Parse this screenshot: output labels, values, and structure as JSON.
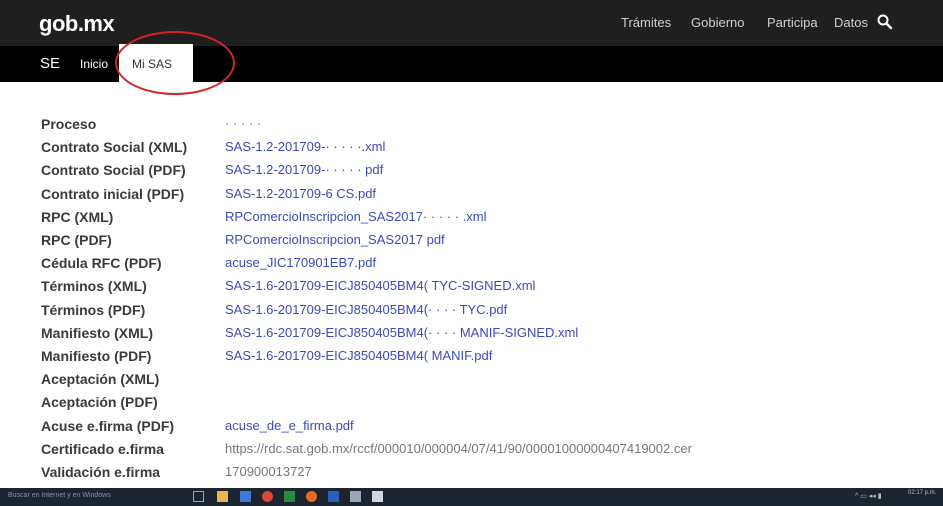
{
  "header": {
    "logo": "gob.mx",
    "nav": [
      "Trámites",
      "Gobierno",
      "Participa",
      "Datos"
    ]
  },
  "subnav": {
    "se": "SE",
    "inicio": "Inicio",
    "mi_sas": "Mi SAS"
  },
  "rows": [
    {
      "label": "Proceso",
      "value": "· · · · ·",
      "link": false
    },
    {
      "label": "Contrato Social (XML)",
      "value": "SAS-1.2-201709-· · · · ·.xml",
      "link": true
    },
    {
      "label": "Contrato Social (PDF)",
      "value": "SAS-1.2-201709-· · · · · pdf",
      "link": true
    },
    {
      "label": "Contrato inicial (PDF)",
      "value": "SAS-1.2-201709-6        CS.pdf",
      "link": true
    },
    {
      "label": "RPC (XML)",
      "value": "RPComercioInscripcion_SAS2017· · · · · .xml",
      "link": true
    },
    {
      "label": "RPC (PDF)",
      "value": "RPComercioInscripcion_SAS2017           pdf",
      "link": true
    },
    {
      "label": "Cédula RFC (PDF)",
      "value": "acuse_JIC170901EB7.pdf",
      "link": true
    },
    {
      "label": "Términos (XML)",
      "value": "SAS-1.6-201709-EICJ850405BM4(        TYC-SIGNED.xml",
      "link": true
    },
    {
      "label": "Términos (PDF)",
      "value": "SAS-1.6-201709-EICJ850405BM4(· · · · TYC.pdf",
      "link": true
    },
    {
      "label": "Manifiesto (XML)",
      "value": "SAS-1.6-201709-EICJ850405BM4(· · · · MANIF-SIGNED.xml",
      "link": true
    },
    {
      "label": "Manifiesto (PDF)",
      "value": "SAS-1.6-201709-EICJ850405BM4(         MANIF.pdf",
      "link": true
    },
    {
      "label": "Aceptación (XML)",
      "value": "",
      "link": false
    },
    {
      "label": "Aceptación (PDF)",
      "value": "",
      "link": false
    },
    {
      "label": "Acuse e.firma (PDF)",
      "value": "acuse_de_e_firma.pdf",
      "link": true
    },
    {
      "label": "Certificado e.firma",
      "value": "https://rdc.sat.gob.mx/rccf/000010/000004/07/41/90/00001000000407419002.cer",
      "link": false
    },
    {
      "label": "Validación e.firma",
      "value": "170900013727",
      "link": false
    }
  ],
  "taskbar": {
    "search_placeholder": "Buscar en Internet y en Windows",
    "clock": "02:17 p.m."
  },
  "colors": {
    "topbar": "#1f1f1f",
    "subbar": "#000000",
    "link": "#3b4bb7",
    "label": "#3a3a3a",
    "highlight_circle": "#d32525",
    "taskbar": "#1c2430"
  }
}
